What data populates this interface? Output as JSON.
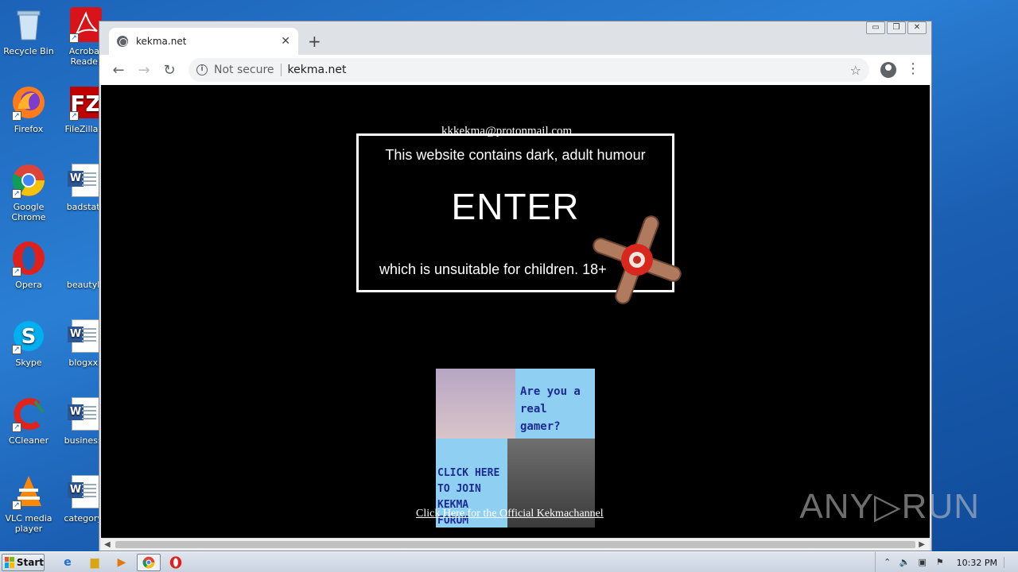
{
  "desktop": {
    "icons_left": [
      {
        "label": "Recycle Bin",
        "icon": "recycle-bin-icon"
      },
      {
        "label": "Firefox",
        "icon": "firefox-icon"
      },
      {
        "label": "Google Chrome",
        "icon": "chrome-icon"
      },
      {
        "label": "Opera",
        "icon": "opera-icon"
      },
      {
        "label": "Skype",
        "icon": "skype-icon"
      },
      {
        "label": "CCleaner",
        "icon": "ccleaner-icon"
      },
      {
        "label": "VLC media player",
        "icon": "vlc-icon"
      }
    ],
    "icons_right": [
      {
        "label": "Acrobat Reader",
        "icon": "acrobat-icon"
      },
      {
        "label": "FileZilla C",
        "icon": "filezilla-icon"
      },
      {
        "label": "badstate",
        "icon": "word-doc-icon"
      },
      {
        "label": "beautyk.",
        "icon": "blank-file-icon"
      },
      {
        "label": "blogxxx",
        "icon": "word-doc-icon"
      },
      {
        "label": "businesse",
        "icon": "word-doc-icon"
      },
      {
        "label": "categorya",
        "icon": "word-doc-icon"
      }
    ]
  },
  "browser": {
    "tab_title": "kekma.net",
    "address": {
      "security_label": "Not secure",
      "url": "kekma.net"
    },
    "window_controls": {
      "minimize": "▭",
      "restore": "❐",
      "close": "✕"
    }
  },
  "page": {
    "email": "kkkekma@protonmail.com",
    "warning_top": "This website contains dark, adult humour",
    "enter_label": "ENTER",
    "warning_bottom": "which is unsuitable for children. 18+",
    "promo": {
      "top_right": "Are you a real gamer?",
      "bottom_left": "CLICK HERE TO JOIN KEKMA FORUM"
    },
    "channel_link": "Click Here for the Official Kekmachannel"
  },
  "watermark": "ANY▷RUN",
  "taskbar": {
    "start_label": "Start",
    "clock": "10:32 PM",
    "pinned": [
      "ie-icon",
      "explorer-icon",
      "media-player-icon",
      "chrome-icon",
      "opera-icon"
    ]
  }
}
